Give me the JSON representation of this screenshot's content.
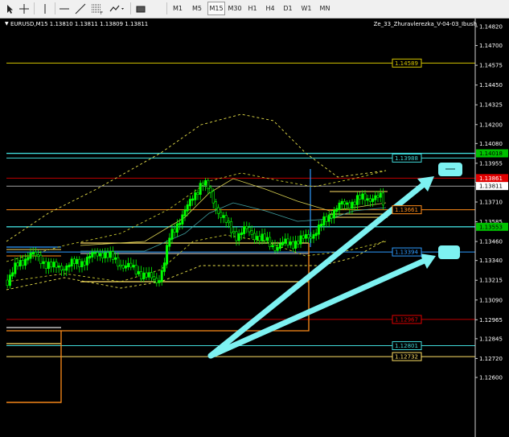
{
  "toolbar": {
    "tools": [
      {
        "icon": "cursor-arrow-icon"
      },
      {
        "icon": "crosshair-icon"
      },
      {
        "icon": "vertical-line-icon"
      },
      {
        "icon": "horizontal-line-icon"
      },
      {
        "icon": "trendline-icon"
      },
      {
        "icon": "fibonacci-icon"
      },
      {
        "icon": "shapes-dropdown-icon"
      },
      {
        "icon": "timeframe-panel-icon"
      }
    ],
    "timeframes": [
      "M1",
      "M5",
      "M15",
      "M30",
      "H1",
      "H4",
      "D1",
      "W1",
      "MN"
    ],
    "active_timeframe": "M15"
  },
  "chart": {
    "symbol_info": "EURUSD,M15  1.13810 1.13811 1.13809 1.13811",
    "indicator_name": "Ze_33_Zhuravlerezka_V-04-03_Ibush",
    "price_axis": [
      "1.14820",
      "1.14700",
      "1.14575",
      "1.14450",
      "1.14325",
      "1.14200",
      "1.14080",
      "1.13955",
      "1.13835",
      "1.13710",
      "1.13585",
      "1.13460",
      "1.13340",
      "1.13215",
      "1.13090",
      "1.12965",
      "1.12845",
      "1.12720",
      "1.12600"
    ],
    "axis_markers": [
      {
        "price": "1.14018",
        "color": "#00c000",
        "text_color": "#000000"
      },
      {
        "price": "1.13861",
        "color": "#e00000",
        "text_color": "#ffffff"
      },
      {
        "price": "1.13811",
        "color": "#ffffff",
        "text_color": "#000000"
      },
      {
        "price": "1.13553",
        "color": "#00c000",
        "text_color": "#000000"
      }
    ],
    "level_labels": [
      {
        "price": "1.14589",
        "color": "#d4c400"
      },
      {
        "price": "1.13988",
        "color": "#40d8d8"
      },
      {
        "price": "1.13661",
        "color": "#ff8c1a"
      },
      {
        "price": "1.13394",
        "color": "#2e9bff"
      },
      {
        "price": "1.12967",
        "color": "#e00000"
      },
      {
        "price": "1.12801",
        "color": "#40d8d8"
      },
      {
        "price": "1.12732",
        "color": "#ffe066"
      }
    ],
    "colors": {
      "background": "#000000",
      "candle_bull": "#00ff00",
      "annotation_arrow": "#7df2f2",
      "channel": "#e8e04a"
    }
  }
}
